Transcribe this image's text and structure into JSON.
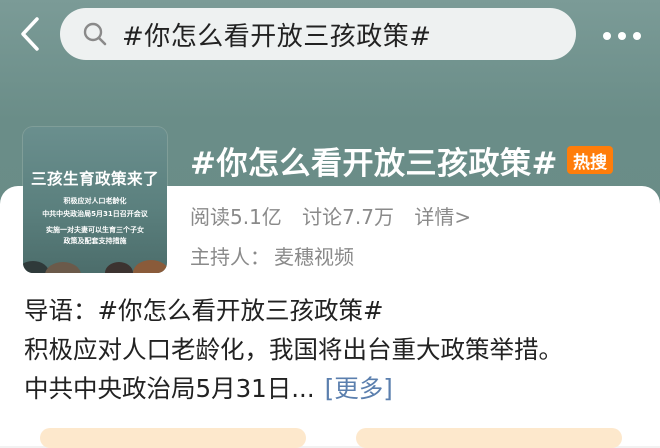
{
  "header": {
    "search_text": "#你怎么看开放三孩政策#"
  },
  "colors": {
    "header_bg": "#6b8c86",
    "hot_badge": "#ff7d0a",
    "link": "#5b7fae"
  },
  "cover": {
    "title": "三孩生育政策来了",
    "lines": [
      "积极应对人口老龄化",
      "中共中央政治局5月31日召开会议",
      "实施一对夫妻可以生育三个子女",
      "政策及配套支持措施"
    ]
  },
  "topic": {
    "title": "#你怎么看开放三孩政策#",
    "badge": "热搜",
    "reads": "阅读5.1亿",
    "discussions": "讨论7.7万",
    "details": "详情>",
    "host_label": "主持人：",
    "host_name": "麦穗视频"
  },
  "intro": {
    "line1": "导语：#你怎么看开放三孩政策#",
    "line2": "积极应对人口老龄化，我国将出台重大政策举措。",
    "line3": "中共中央政治局5月31日...",
    "more": "[更多]"
  },
  "icons": [
    "back-arrow-icon",
    "search-icon",
    "more-dots-icon"
  ]
}
